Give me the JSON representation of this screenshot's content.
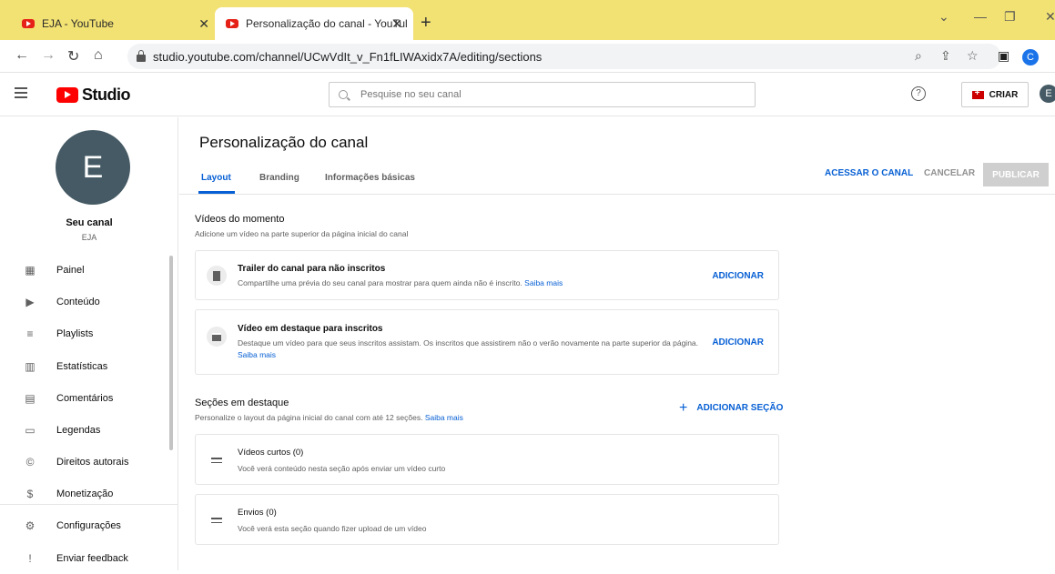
{
  "browser": {
    "tabs": [
      {
        "label": "EJA - YouTube"
      },
      {
        "label": "Personalização do canal - YouTul"
      }
    ],
    "url": "studio.youtube.com/channel/UCwVdIt_v_Fn1fLIWAxidx7A/editing/sections",
    "profile_initial": "C"
  },
  "header": {
    "logo_text": "Studio",
    "search_placeholder": "Pesquise no seu canal",
    "create_label": "CRIAR",
    "account_initial": "E"
  },
  "sidebar": {
    "avatar_initial": "E",
    "channel_title": "Seu canal",
    "channel_name": "EJA",
    "items": [
      {
        "label": "Painel",
        "icon": "dashboard-icon"
      },
      {
        "label": "Conteúdo",
        "icon": "content-icon"
      },
      {
        "label": "Playlists",
        "icon": "playlists-icon"
      },
      {
        "label": "Estatísticas",
        "icon": "analytics-icon"
      },
      {
        "label": "Comentários",
        "icon": "comments-icon"
      },
      {
        "label": "Legendas",
        "icon": "subtitles-icon"
      },
      {
        "label": "Direitos autorais",
        "icon": "copyright-icon"
      },
      {
        "label": "Monetização",
        "icon": "monetization-icon"
      },
      {
        "label": "Configurações",
        "icon": "settings-icon"
      },
      {
        "label": "Enviar feedback",
        "icon": "feedback-icon"
      }
    ]
  },
  "main": {
    "title": "Personalização do canal",
    "tabs": [
      {
        "label": "Layout",
        "active": true
      },
      {
        "label": "Branding"
      },
      {
        "label": "Informações básicas"
      }
    ],
    "actions": {
      "view_channel": "ACESSAR O CANAL",
      "cancel": "CANCELAR",
      "publish": "PUBLICAR"
    },
    "featured_video": {
      "title": "Vídeos do momento",
      "description": "Adicione um vídeo na parte superior da página inicial do canal",
      "cards": [
        {
          "title": "Trailer do canal para não inscritos",
          "description": "Compartilhe uma prévia do seu canal para mostrar para quem ainda não é inscrito.",
          "learn_more": "Saiba mais",
          "action": "ADICIONAR"
        },
        {
          "title": "Vídeo em destaque para inscritos",
          "description": "Destaque um vídeo para que seus inscritos assistam. Os inscritos que assistirem não o verão novamente na parte superior da página.",
          "learn_more": "Saiba mais",
          "action": "ADICIONAR"
        }
      ]
    },
    "featured_sections": {
      "title": "Seções em destaque",
      "description": "Personalize o layout da página inicial do canal com até 12 seções.",
      "learn_more": "Saiba mais",
      "add_label": "ADICIONAR SEÇÃO",
      "rows": [
        {
          "title": "Vídeos curtos (0)",
          "description": "Você verá conteúdo nesta seção após enviar um vídeo curto"
        },
        {
          "title": "Envios (0)",
          "description": "Você verá esta seção quando fizer upload de um vídeo"
        }
      ]
    }
  },
  "colors": {
    "accent": "#065fd4",
    "tabbar": "#f2e173",
    "brand_red": "#ff0000"
  }
}
